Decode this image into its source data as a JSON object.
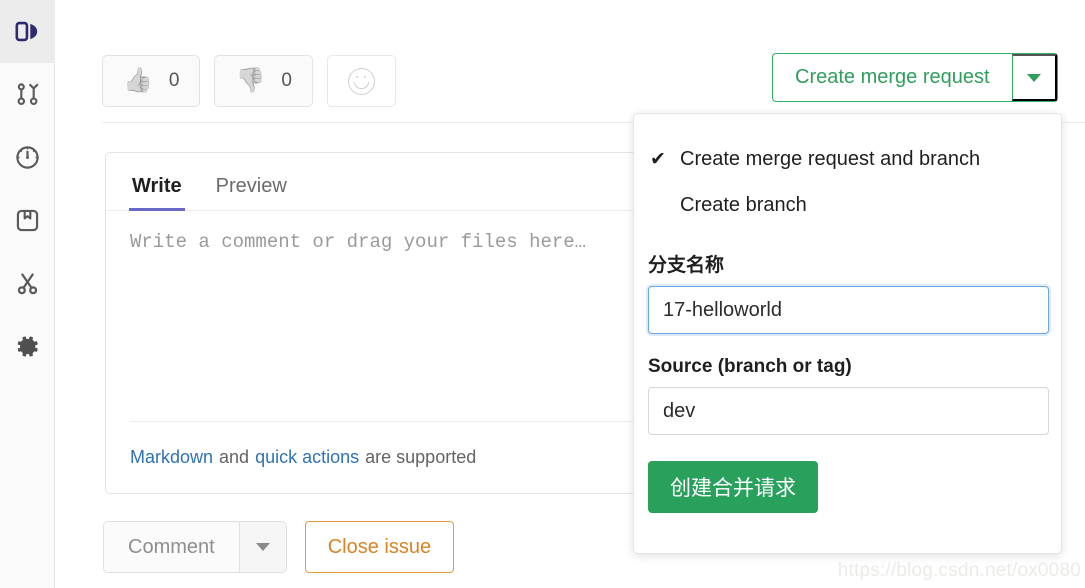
{
  "sidebar": {
    "items": [
      {
        "name": "issues-icon",
        "label": "Issues",
        "active": true
      },
      {
        "name": "merge-requests-icon",
        "label": "Merge requests",
        "active": false
      },
      {
        "name": "cicd-gauge-icon",
        "label": "CI/CD",
        "active": false
      },
      {
        "name": "packages-icon",
        "label": "Packages",
        "active": false
      },
      {
        "name": "snippets-scissors-icon",
        "label": "Snippets",
        "active": false
      },
      {
        "name": "settings-gear-icon",
        "label": "Settings",
        "active": false
      }
    ]
  },
  "awards": {
    "thumbs_up": {
      "emoji": "👍",
      "count": "0"
    },
    "thumbs_down": {
      "emoji": "👎",
      "count": "0"
    },
    "add_reaction_label": ""
  },
  "create_merge_request": {
    "button_label": "Create merge request",
    "caret_icon": "chevron-down-icon",
    "accent_color": "#2f9e5d"
  },
  "dropdown": {
    "options": [
      {
        "check": "✔",
        "label": "Create merge request and branch",
        "selected": true
      },
      {
        "check": "",
        "label": "Create branch",
        "selected": false
      }
    ],
    "branch_name": {
      "label": "分支名称",
      "value": "17-helloworld",
      "placeholder": "",
      "focused": true
    },
    "source": {
      "label": "Source (branch or tag)",
      "value": "dev",
      "placeholder": ""
    },
    "submit_label": "创建合并请求",
    "submit_color": "#29a05b"
  },
  "comment_editor": {
    "tabs": [
      {
        "label": "Write",
        "active": true
      },
      {
        "label": "Preview",
        "active": false
      }
    ],
    "textarea_value": "",
    "textarea_placeholder": "Write a comment or drag your files here…",
    "footer": {
      "markdown_link": "Markdown",
      "and_text": "and",
      "quick_actions_link": "quick actions",
      "suffix_text": "are supported"
    }
  },
  "bottom_actions": {
    "comment_label": "Comment",
    "comment_caret_icon": "chevron-down-icon",
    "close_issue_label": "Close issue",
    "close_issue_color": "#d98326"
  },
  "watermark": "https://blog.csdn.net/ox0080"
}
